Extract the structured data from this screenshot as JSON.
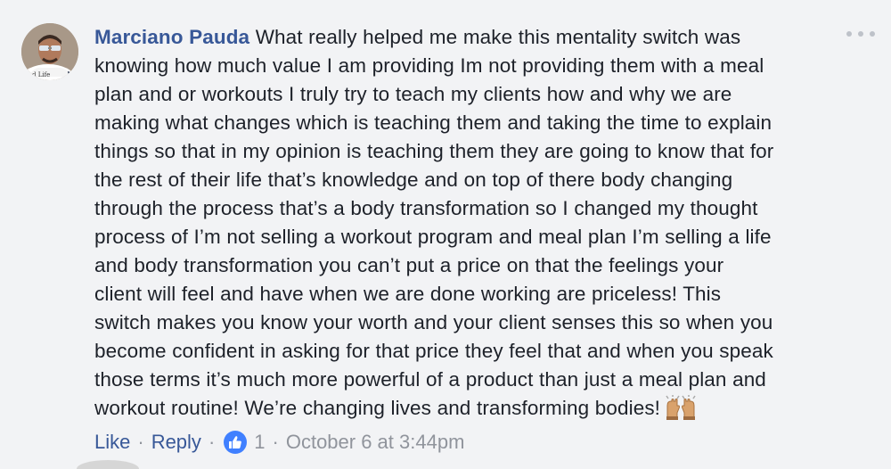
{
  "comment": {
    "author": "Marciano Pauda",
    "lines": [
      " What really helped me make this mentality switch was",
      "knowing how much value I am providing Im not providing them with a meal",
      "plan and or workouts I truly try to teach my clients how and why we are",
      "making what changes which is teaching them and taking the time to explain",
      "things so that in my opinion is teaching them they are going to know that for",
      "the rest of their life that’s knowledge and on top of there body changing",
      "through the process that’s a body transformation so I changed my thought",
      "process of I’m not selling a workout program and meal plan I’m selling a life",
      "and body transformation you can’t put a price on that the feelings your",
      "client will feel and have when we are done working are priceless! This",
      "switch makes you know your worth and your client senses this so when you",
      "become confident in asking for that price they feel that and when you speak",
      "those terms it’s much more powerful of a product than just a meal plan and",
      "workout routine! We’re changing lives and transforming bodies!"
    ],
    "emoji_icon": "raising-hands-icon",
    "actions": {
      "like_label": "Like",
      "reply_label": "Reply",
      "separator": "·",
      "reaction_icon": "thumbs-up-icon",
      "reaction_count": "1",
      "timestamp": "October 6 at 3:44pm"
    },
    "more_icon": "more-options-icon"
  },
  "colors": {
    "background": "#f2f3f5",
    "text": "#1d2129",
    "link": "#385898",
    "meta": "#90949c",
    "like_blue": "#4080ff"
  }
}
